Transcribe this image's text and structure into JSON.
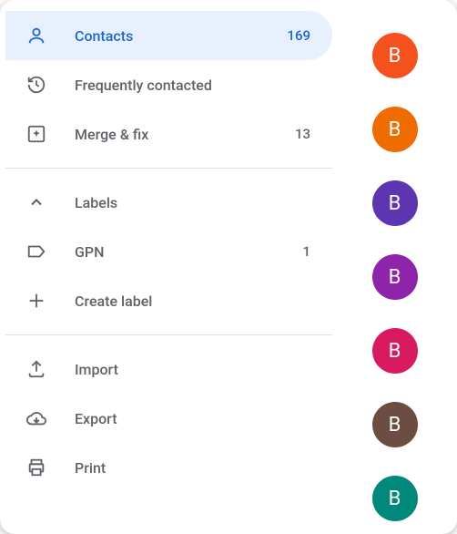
{
  "sidebar": {
    "contacts": {
      "label": "Contacts",
      "count": "169"
    },
    "frequent": {
      "label": "Frequently contacted"
    },
    "merge": {
      "label": "Merge & fix",
      "count": "13"
    },
    "labels_header": {
      "label": "Labels"
    },
    "gpn": {
      "label": "GPN",
      "count": "1"
    },
    "create": {
      "label": "Create label"
    },
    "import": {
      "label": "Import"
    },
    "export": {
      "label": "Export"
    },
    "print": {
      "label": "Print"
    }
  },
  "avatars": [
    {
      "letter": "B",
      "color": "#f4511e"
    },
    {
      "letter": "B",
      "color": "#ef6c00"
    },
    {
      "letter": "B",
      "color": "#5e35b1"
    },
    {
      "letter": "B",
      "color": "#8e24aa"
    },
    {
      "letter": "B",
      "color": "#d81b60"
    },
    {
      "letter": "B",
      "color": "#6d4c41"
    },
    {
      "letter": "B",
      "color": "#00897b"
    }
  ]
}
